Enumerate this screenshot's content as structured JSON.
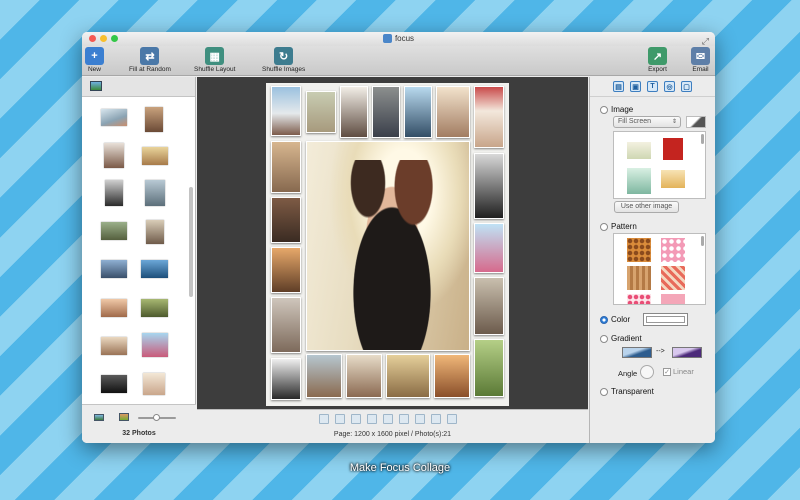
{
  "window": {
    "title": "focus"
  },
  "toolbar": {
    "new": "New",
    "fill_random": "Fill at Random",
    "shuffle_layout": "Shuffle Layout",
    "shuffle_images": "Shuffle Images",
    "export": "Export",
    "email": "Email"
  },
  "sidebar": {
    "photo_count": "32 Photos"
  },
  "status": {
    "page_info": "Page: 1200 x 1600 pixel / Photo(s):21"
  },
  "panel": {
    "image_label": "Image",
    "fill_mode": "Fill Screen",
    "use_other_image": "Use other image",
    "pattern_label": "Pattern",
    "color_label": "Color",
    "gradient_label": "Gradient",
    "gradient_arrow": "-->",
    "angle_label": "Angle",
    "linear_label": "Linear",
    "transparent_label": "Transparent",
    "selected": "Color"
  },
  "colors": {
    "accent": "#2c7ed8",
    "canvas_bg": "#3d3d3d",
    "desktop_stripe_light": "#8ed3f1",
    "desktop_stripe_dark": "#4fb6e8"
  },
  "caption": "Make Focus Collage"
}
